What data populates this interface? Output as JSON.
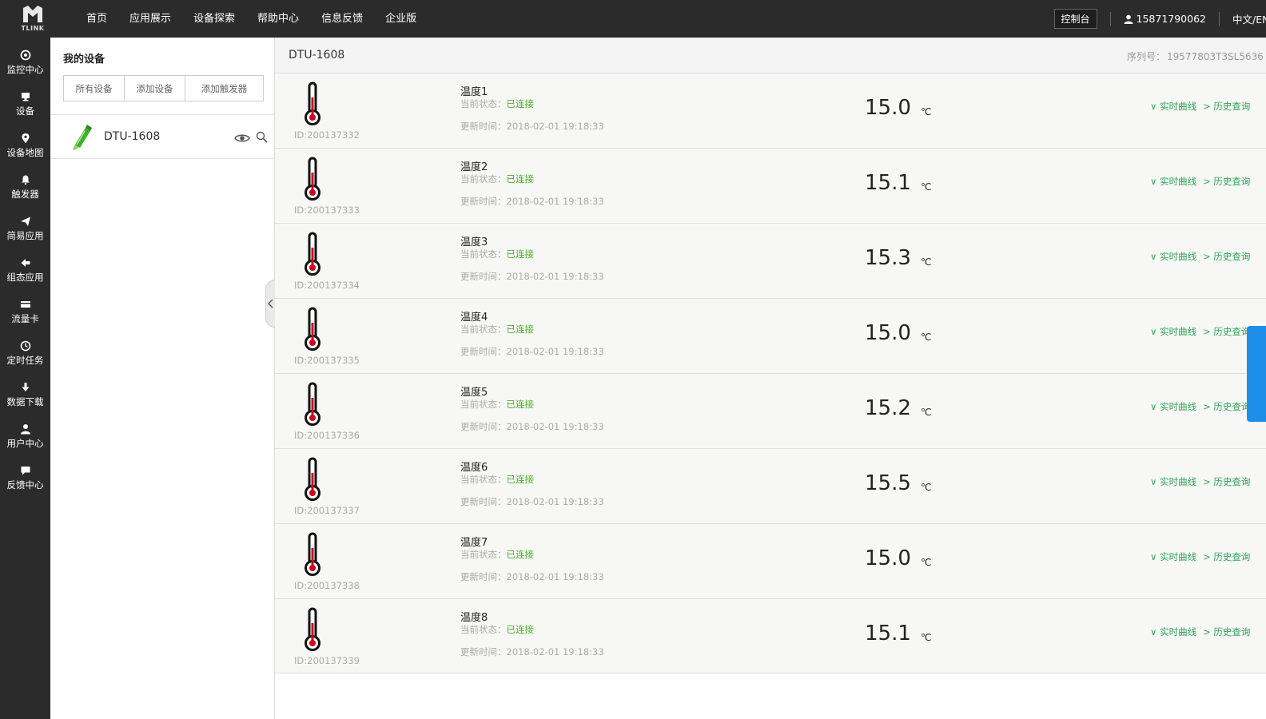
{
  "topbar": {
    "logo_text": "TLINK",
    "nav": [
      "首页",
      "应用展示",
      "设备探索",
      "帮助中心",
      "信息反馈",
      "企业版"
    ],
    "console": "控制台",
    "user": "15871790062",
    "lang": "中文/EN"
  },
  "sidebar": {
    "items": [
      {
        "label": "监控中心",
        "icon": "monitor-icon"
      },
      {
        "label": "设备",
        "icon": "device-icon"
      },
      {
        "label": "设备地图",
        "icon": "map-pin-icon"
      },
      {
        "label": "触发器",
        "icon": "bell-icon"
      },
      {
        "label": "简易应用",
        "icon": "send-icon"
      },
      {
        "label": "组态应用",
        "icon": "arrow-left-icon"
      },
      {
        "label": "流量卡",
        "icon": "card-icon"
      },
      {
        "label": "定时任务",
        "icon": "clock-icon"
      },
      {
        "label": "数据下载",
        "icon": "download-icon"
      },
      {
        "label": "用户中心",
        "icon": "user-icon"
      },
      {
        "label": "反馈中心",
        "icon": "chat-icon"
      }
    ]
  },
  "devpanel": {
    "title": "我的设备",
    "tabs": [
      "所有设备",
      "添加设备",
      "添加触发器"
    ],
    "device": "DTU-1608"
  },
  "main": {
    "title": "DTU-1608",
    "serial_label": "序列号：",
    "serial_value": "19577803T3SL5636",
    "status_label": "当前状态：",
    "update_label": "更新时间：",
    "unit": "℃",
    "link_curve": "实时曲线",
    "link_history": "历史查询",
    "sensors": [
      {
        "name": "温度1",
        "id": "ID:200137332",
        "status": "已连接",
        "time": "2018-02-01 19:18:33",
        "value": "15.0"
      },
      {
        "name": "温度2",
        "id": "ID:200137333",
        "status": "已连接",
        "time": "2018-02-01 19:18:33",
        "value": "15.1"
      },
      {
        "name": "温度3",
        "id": "ID:200137334",
        "status": "已连接",
        "time": "2018-02-01 19:18:33",
        "value": "15.3"
      },
      {
        "name": "温度4",
        "id": "ID:200137335",
        "status": "已连接",
        "time": "2018-02-01 19:18:33",
        "value": "15.0"
      },
      {
        "name": "温度5",
        "id": "ID:200137336",
        "status": "已连接",
        "time": "2018-02-01 19:18:33",
        "value": "15.2"
      },
      {
        "name": "温度6",
        "id": "ID:200137337",
        "status": "已连接",
        "time": "2018-02-01 19:18:33",
        "value": "15.5"
      },
      {
        "name": "温度7",
        "id": "ID:200137338",
        "status": "已连接",
        "time": "2018-02-01 19:18:33",
        "value": "15.0"
      },
      {
        "name": "温度8",
        "id": "ID:200137339",
        "status": "已连接",
        "time": "2018-02-01 19:18:33",
        "value": "15.1"
      }
    ]
  },
  "colors": {
    "dark_bar": "#2b2b2b",
    "status_green": "#4caf2a",
    "link_green": "#2fa45a",
    "thermometer_red": "#d0021b",
    "right_tab_blue": "#1e8fe8"
  }
}
